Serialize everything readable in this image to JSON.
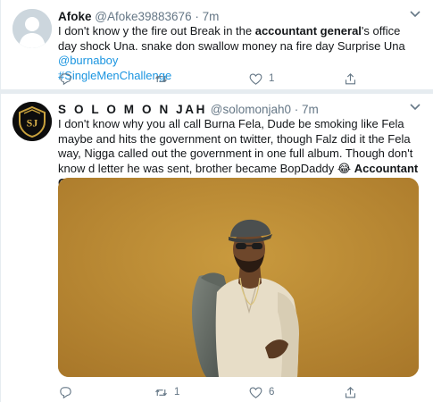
{
  "tweets": [
    {
      "name": "Afoke",
      "handle": "@Afoke39883676",
      "dot": "·",
      "time": "7m",
      "text_1": "I don't know y the fire out Break in the ",
      "text_bold_1": "accountant general",
      "text_2": "'s office day shock Una. snake don swallow money na fire day Surprise Una ",
      "mention": "@burnaboy",
      "hashtag": "#SingleMenChallenge",
      "actions": {
        "reply_count": "",
        "retweet_count": "",
        "like_count": "1"
      },
      "icons": [
        "reply-icon",
        "retweet-icon",
        "like-icon",
        "share-icon"
      ]
    },
    {
      "name": "S O L O M O N JAH",
      "handle": "@solomonjah0",
      "dot": "·",
      "time": "7m",
      "avatar_text": "SJ",
      "text_1": "I don't know why you all call Burna Fela, Dude be smoking like Fela maybe and hits the government on twitter, though Falz did it the Fela way, Nigga called out the government in one full album. Though don't know d letter he was sent, brother became BopDaddy ",
      "emoji": "😂",
      "text_bold_1": "Accountant General",
      "actions": {
        "reply_count": "",
        "retweet_count": "1",
        "like_count": "6"
      },
      "icons": [
        "reply-icon",
        "retweet-icon",
        "like-icon",
        "share-icon"
      ]
    }
  ],
  "colors": {
    "link": "#1b95e0",
    "muted": "#657786",
    "separator": "#e6ecf0",
    "media_background": "#b8862f"
  }
}
